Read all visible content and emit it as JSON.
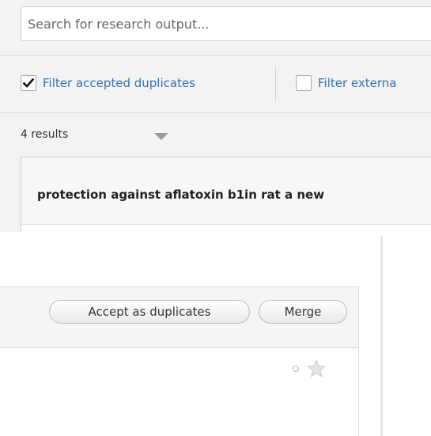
{
  "search": {
    "placeholder": "Search for research output..."
  },
  "filters": [
    {
      "label": "Filter accepted duplicates",
      "checked": true
    },
    {
      "label": "Filter externa",
      "checked": false
    }
  ],
  "results": {
    "count_label": "4 results"
  },
  "result_item": {
    "title": "protection against aflatoxin b1in rat a new"
  },
  "duplicates": {
    "accept_label": "Accept as duplicates",
    "merge_label": "Merge"
  },
  "icons": {
    "checkmark": "checkmark-icon",
    "sort": "caret-down-icon",
    "status": "circle-icon",
    "favorite": "star-icon"
  },
  "colors": {
    "link": "#2f73b5",
    "panel_background": "#f3f3f3",
    "star": "#d6d6d6"
  }
}
